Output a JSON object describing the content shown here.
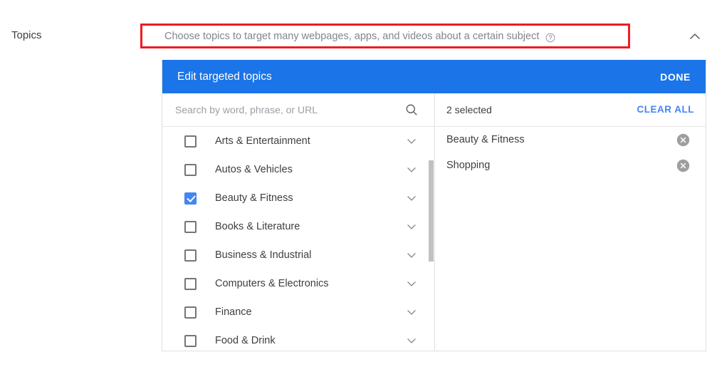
{
  "colors": {
    "accent_blue": "#1b74e8",
    "link_blue": "#4285f4",
    "highlight_red": "#ed1c24",
    "text_primary": "#3c4043",
    "text_muted": "#9aa0a6",
    "checkbox_border": "#757575",
    "divider": "#e0e0e0",
    "scrollbar_thumb": "#c1c1c1",
    "remove_icon_gray": "#9e9e9e"
  },
  "topics_row": {
    "label": "Topics",
    "field_placeholder": "Choose topics to target many webpages, apps, and videos about a certain subject",
    "help_icon": "help-circle-icon",
    "collapse_icon": "chevron-up-icon"
  },
  "dialog": {
    "title": "Edit targeted topics",
    "done_label": "DONE",
    "search": {
      "placeholder": "Search by word, phrase, or URL",
      "value": "",
      "icon": "search-icon"
    },
    "topics": [
      {
        "label": "Arts & Entertainment",
        "checked": false,
        "expand_icon": "chevron-down-icon"
      },
      {
        "label": "Autos & Vehicles",
        "checked": false,
        "expand_icon": "chevron-down-icon"
      },
      {
        "label": "Beauty & Fitness",
        "checked": true,
        "expand_icon": "chevron-down-icon"
      },
      {
        "label": "Books & Literature",
        "checked": false,
        "expand_icon": "chevron-down-icon"
      },
      {
        "label": "Business & Industrial",
        "checked": false,
        "expand_icon": "chevron-down-icon"
      },
      {
        "label": "Computers & Electronics",
        "checked": false,
        "expand_icon": "chevron-down-icon"
      },
      {
        "label": "Finance",
        "checked": false,
        "expand_icon": "chevron-down-icon"
      },
      {
        "label": "Food & Drink",
        "checked": false,
        "expand_icon": "chevron-down-icon"
      }
    ],
    "selected_panel": {
      "count_label": "2 selected",
      "clear_all_label": "CLEAR ALL",
      "items": [
        {
          "label": "Beauty & Fitness",
          "remove_icon": "remove-circle-x-icon"
        },
        {
          "label": "Shopping",
          "remove_icon": "remove-circle-x-icon"
        }
      ]
    }
  }
}
